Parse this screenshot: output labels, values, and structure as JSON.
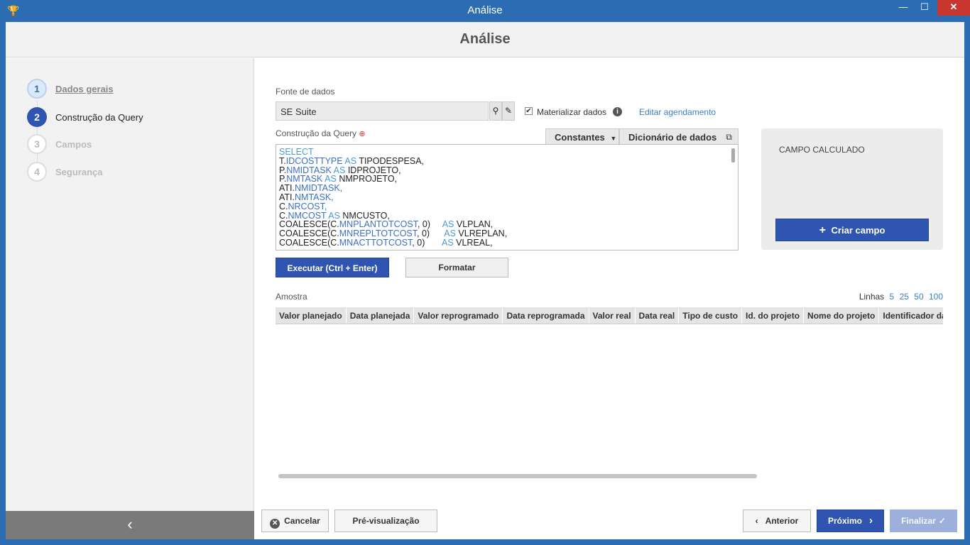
{
  "window": {
    "title": "Análise",
    "minimize": "—",
    "maximize": "☐",
    "close": "✕"
  },
  "header": {
    "title": "Análise"
  },
  "steps": [
    {
      "num": "1",
      "label": "Dados gerais"
    },
    {
      "num": "2",
      "label": "Construção da Query"
    },
    {
      "num": "3",
      "label": "Campos"
    },
    {
      "num": "4",
      "label": "Segurança"
    }
  ],
  "sidebar": {
    "collapse_glyph": "‹"
  },
  "fonte": {
    "label": "Fonte de dados",
    "value": "SE Suite",
    "materializar_label": "Materializar dados",
    "materializar_checked": true,
    "editar_agendamento": "Editar agendamento"
  },
  "query": {
    "label": "Construção da Query",
    "required_mark": "⊕",
    "tab_constantes": "Constantes",
    "tab_dicionario": "Dicionário de dados",
    "lines": [
      [
        {
          "t": "kw",
          "v": "SELECT"
        }
      ],
      [
        {
          "t": "plain",
          "v": "T."
        },
        {
          "t": "fld",
          "v": "IDCOSTTYPE"
        },
        {
          "t": "kw",
          "v": " AS "
        },
        {
          "t": "plain",
          "v": "TIPODESPESA,"
        }
      ],
      [
        {
          "t": "plain",
          "v": "P."
        },
        {
          "t": "fld",
          "v": "NMIDTASK"
        },
        {
          "t": "kw",
          "v": " AS "
        },
        {
          "t": "plain",
          "v": "IDPROJETO,"
        }
      ],
      [
        {
          "t": "plain",
          "v": "P."
        },
        {
          "t": "fld",
          "v": "NMTASK"
        },
        {
          "t": "kw",
          "v": " AS "
        },
        {
          "t": "plain",
          "v": "NMPROJETO,"
        }
      ],
      [
        {
          "t": "plain",
          "v": "ATI."
        },
        {
          "t": "fld",
          "v": "NMIDTASK,"
        }
      ],
      [
        {
          "t": "plain",
          "v": "ATI."
        },
        {
          "t": "fld",
          "v": "NMTASK,"
        }
      ],
      [
        {
          "t": "plain",
          "v": "C."
        },
        {
          "t": "fld",
          "v": "NRCOST,"
        }
      ],
      [
        {
          "t": "plain",
          "v": "C."
        },
        {
          "t": "fld",
          "v": "NMCOST"
        },
        {
          "t": "kw",
          "v": " AS "
        },
        {
          "t": "plain",
          "v": "NMCUSTO,"
        }
      ],
      [
        {
          "t": "plain",
          "v": "COALESCE(C."
        },
        {
          "t": "fld",
          "v": "MNPLANTOTCOST"
        },
        {
          "t": "plain",
          "v": ", 0)     "
        },
        {
          "t": "kw",
          "v": "AS "
        },
        {
          "t": "plain",
          "v": "VLPLAN,"
        }
      ],
      [
        {
          "t": "plain",
          "v": "COALESCE(C."
        },
        {
          "t": "fld",
          "v": "MNREPLTOTCOST"
        },
        {
          "t": "plain",
          "v": ", 0)      "
        },
        {
          "t": "kw",
          "v": "AS "
        },
        {
          "t": "plain",
          "v": "VLREPLAN,"
        }
      ],
      [
        {
          "t": "plain",
          "v": "COALESCE(C."
        },
        {
          "t": "fld",
          "v": "MNACTTOTCOST"
        },
        {
          "t": "plain",
          "v": ", 0)       "
        },
        {
          "t": "kw",
          "v": "AS "
        },
        {
          "t": "plain",
          "v": "VLREAL,"
        }
      ]
    ]
  },
  "campo": {
    "title": "CAMPO CALCULADO",
    "criar": "Criar campo"
  },
  "actions": {
    "executar": "Executar (Ctrl + Enter)",
    "formatar": "Formatar"
  },
  "amostra": {
    "label": "Amostra",
    "linhas_label": "Linhas",
    "linhas_options": [
      "5",
      "25",
      "50",
      "100"
    ],
    "columns": [
      "Valor planejado",
      "Data planejada",
      "Valor reprogramado",
      "Data reprogramada",
      "Valor real",
      "Data real",
      "Tipo de custo",
      "Id. do projeto",
      "Nome do projeto",
      "Identificador da a"
    ]
  },
  "footer": {
    "cancelar": "Cancelar",
    "previsualizacao": "Pré-visualização",
    "anterior": "Anterior",
    "proximo": "Próximo",
    "finalizar": "Finalizar"
  },
  "colors": {
    "primary": "#2f55b0",
    "titlebar": "#2b6cb3",
    "link": "#3b7fc4",
    "close": "#c7372f"
  }
}
